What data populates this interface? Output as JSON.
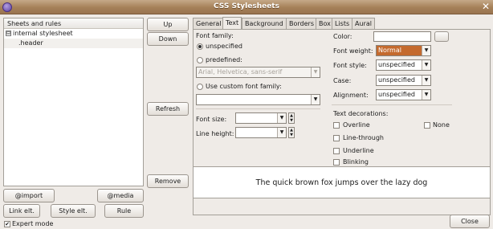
{
  "window": {
    "title": "CSS Stylesheets",
    "close_glyph": "✕"
  },
  "tree": {
    "header": "Sheets and rules",
    "root": {
      "expander": "⊟",
      "label": "internal stylesheet"
    },
    "child": {
      "label": ".header"
    }
  },
  "middle_buttons": {
    "up": "Up",
    "down": "Down",
    "refresh": "Refresh",
    "remove": "Remove"
  },
  "left_buttons": {
    "import": "@import",
    "media": "@media",
    "link": "Link elt.",
    "style": "Style elt.",
    "rule": "Rule",
    "expert_mode": "Expert mode",
    "expert_checked": "✔"
  },
  "tabs": [
    "General",
    "Text",
    "Background",
    "Borders",
    "Box",
    "Lists",
    "Aural"
  ],
  "active_tab": "Text",
  "text_tab": {
    "font_family_label": "Font family:",
    "unspecified": "unspecified",
    "predefined": "predefined:",
    "predefined_value": "Arial, Helvetica, sans-serif",
    "custom": "Use custom font family:",
    "custom_value": "",
    "font_size_label": "Font size:",
    "line_height_label": "Line height:",
    "color_label": "Color:",
    "font_weight_label": "Font weight:",
    "font_weight_value": "Normal",
    "font_weight_bg": "#c46a2e",
    "font_style_label": "Font style:",
    "font_style_value": "unspecified",
    "case_label": "Case:",
    "case_value": "unspecified",
    "alignment_label": "Alignment:",
    "alignment_value": "unspecified",
    "decorations_label": "Text decorations:",
    "decorations": [
      "Overline",
      "Line-through",
      "Underline",
      "Blinking"
    ],
    "none_label": "None",
    "preview_text": "The quick brown fox jumps over the lazy dog"
  },
  "close_button": "Close",
  "icons": {
    "dropdown": "dropdown-arrow-icon",
    "spin": "spin-arrows-icon",
    "app": "app-icon",
    "close": "close-icon"
  }
}
